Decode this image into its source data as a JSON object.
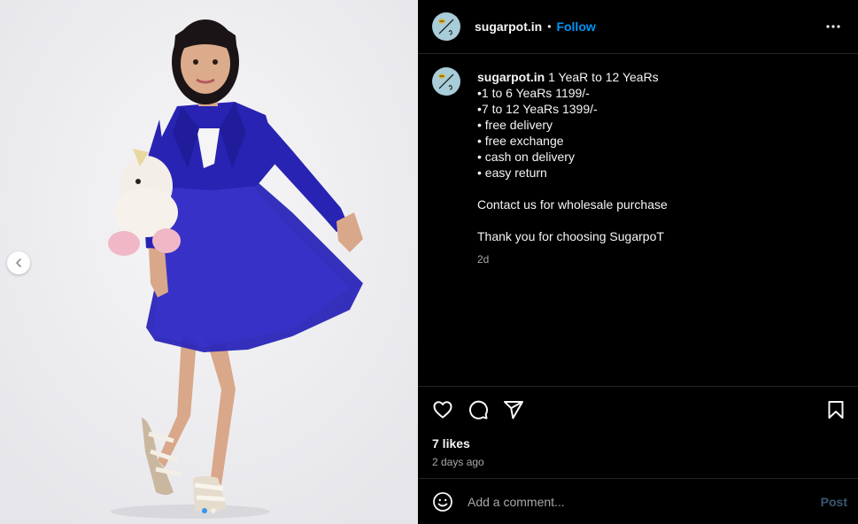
{
  "post": {
    "username": "sugarpot.in",
    "separator": "•",
    "follow_label": "Follow",
    "caption_lines": [
      "1 YeaR to 12 YeaRs",
      "•1 to 6 YeaRs 1199/-",
      "•7 to 12 YeaRs 1399/-",
      "• free delivery",
      "• free exchange",
      "• cash on delivery",
      "• easy return",
      "",
      "Contact us for wholesale purchase",
      "",
      "Thank you for choosing SugarpoT"
    ],
    "caption_time": "2d",
    "likes": "7 likes",
    "posted_ago": "2 days ago"
  },
  "comment_box": {
    "placeholder": "Add a comment...",
    "post_label": "Post"
  },
  "media": {
    "slide_count": 2,
    "active_slide": 1
  },
  "colors": {
    "background": "#000000",
    "follow_accent": "#0095f6",
    "post_disabled": "#3b5674",
    "muted_text": "#a8a8a8",
    "dress_blue": "#2a25b8",
    "divider": "#262626"
  },
  "icons": [
    "chevron-left-icon",
    "more-options-icon",
    "heart-icon",
    "comment-icon",
    "share-icon",
    "bookmark-icon",
    "emoji-icon"
  ]
}
